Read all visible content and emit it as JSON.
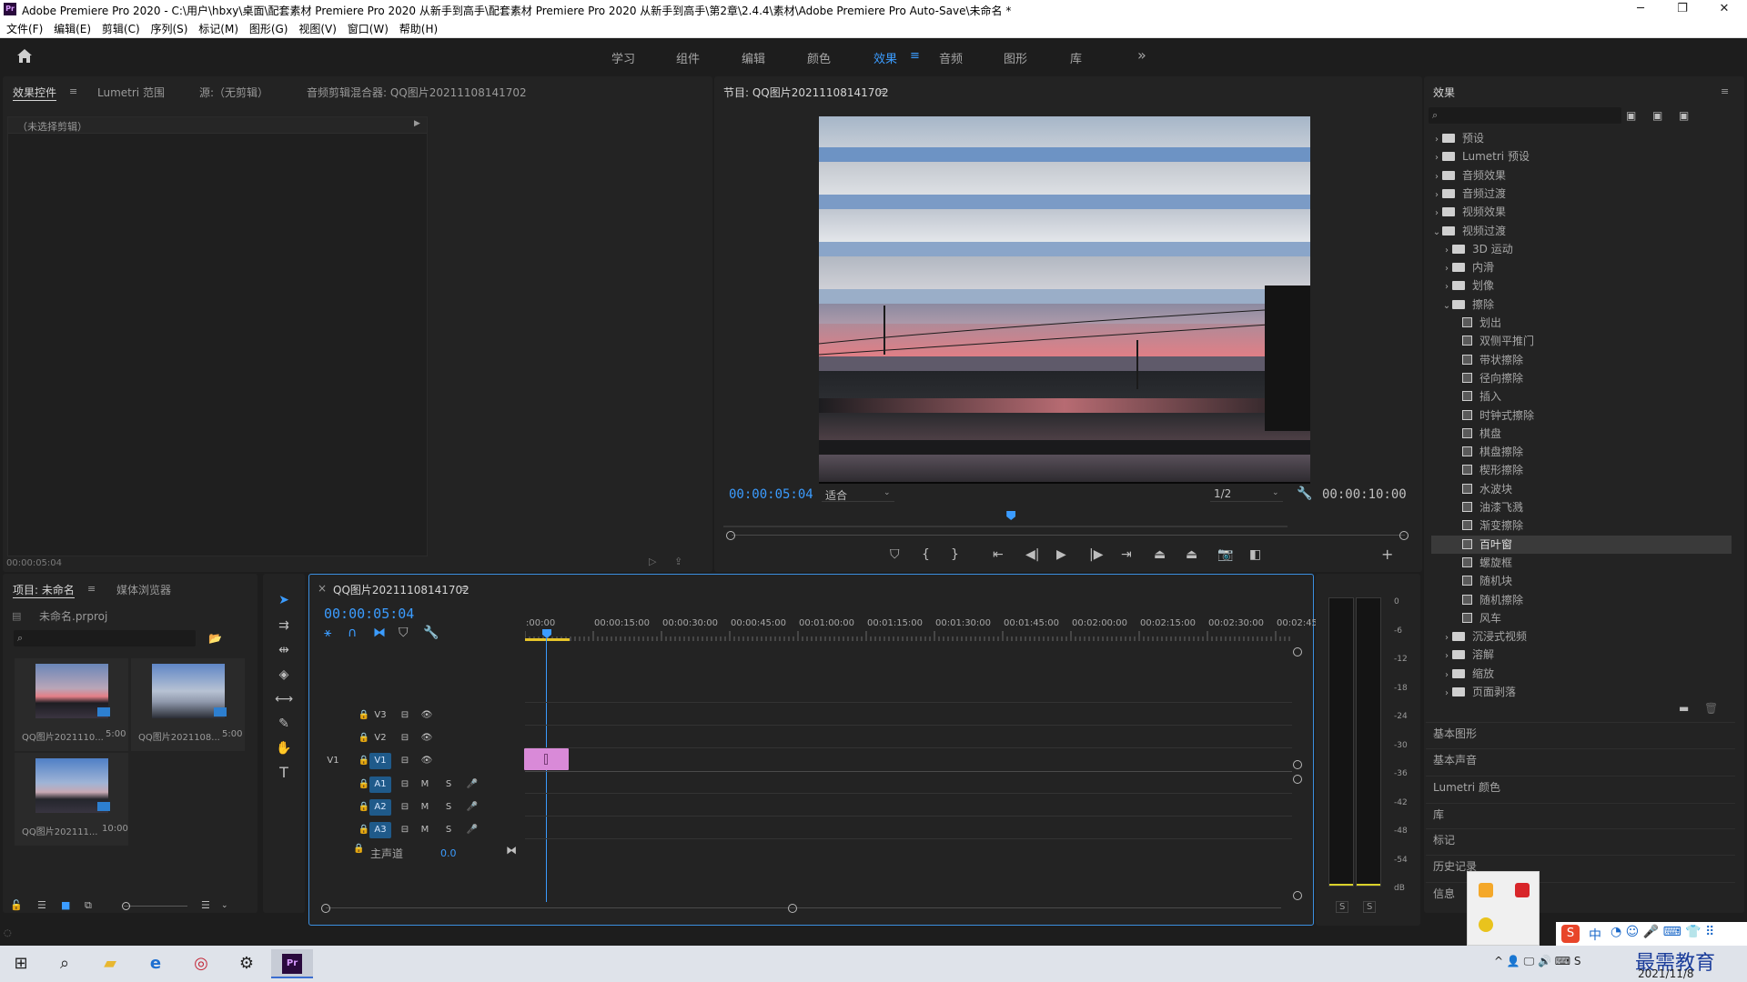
{
  "window": {
    "title": "Adobe Premiere Pro 2020 - C:\\用户\\hbxy\\桌面\\配套素材 Premiere Pro 2020 从新手到高手\\配套素材 Premiere Pro 2020 从新手到高手\\第2章\\2.4.4\\素材\\Adobe Premiere Pro Auto-Save\\未命名 *",
    "logo": "Pr",
    "minimize": "─",
    "maximize": "❐",
    "close": "✕"
  },
  "menu": [
    "文件(F)",
    "编辑(E)",
    "剪辑(C)",
    "序列(S)",
    "标记(M)",
    "图形(G)",
    "视图(V)",
    "窗口(W)",
    "帮助(H)"
  ],
  "workspaces": {
    "items": [
      "学习",
      "组件",
      "编辑",
      "颜色",
      "效果",
      "音频",
      "图形",
      "库"
    ],
    "active": "效果",
    "more": "»"
  },
  "effect_controls": {
    "tabs": [
      "效果控件",
      "Lumetri 范围",
      "源:（无剪辑）",
      "音频剪辑混合器: QQ图片20211108141702"
    ],
    "no_clip": "（未选择剪辑）",
    "timecode": "00:00:05:04"
  },
  "program": {
    "title": "节目: QQ图片20211108141702",
    "timecode": "00:00:05:04",
    "fit": "适合",
    "resolution": "1/2",
    "duration": "00:00:10:00",
    "playhead_fraction": 0.51
  },
  "effects_panel": {
    "title": "效果",
    "tree": [
      {
        "label": "预设",
        "level": 0,
        "kind": "folder-special",
        "open": false
      },
      {
        "label": "Lumetri 预设",
        "level": 0,
        "kind": "folder-special",
        "open": false
      },
      {
        "label": "音频效果",
        "level": 0,
        "kind": "folder",
        "open": false
      },
      {
        "label": "音频过渡",
        "level": 0,
        "kind": "folder",
        "open": false
      },
      {
        "label": "视频效果",
        "level": 0,
        "kind": "folder",
        "open": false
      },
      {
        "label": "视频过渡",
        "level": 0,
        "kind": "folder",
        "open": true
      },
      {
        "label": "3D 运动",
        "level": 1,
        "kind": "folder",
        "open": false
      },
      {
        "label": "内滑",
        "level": 1,
        "kind": "folder",
        "open": false
      },
      {
        "label": "划像",
        "level": 1,
        "kind": "folder",
        "open": false
      },
      {
        "label": "擦除",
        "level": 1,
        "kind": "folder",
        "open": true
      },
      {
        "label": "划出",
        "level": 2,
        "kind": "fx"
      },
      {
        "label": "双侧平推门",
        "level": 2,
        "kind": "fx"
      },
      {
        "label": "带状擦除",
        "level": 2,
        "kind": "fx"
      },
      {
        "label": "径向擦除",
        "level": 2,
        "kind": "fx"
      },
      {
        "label": "插入",
        "level": 2,
        "kind": "fx"
      },
      {
        "label": "时钟式擦除",
        "level": 2,
        "kind": "fx"
      },
      {
        "label": "棋盘",
        "level": 2,
        "kind": "fx"
      },
      {
        "label": "棋盘擦除",
        "level": 2,
        "kind": "fx"
      },
      {
        "label": "楔形擦除",
        "level": 2,
        "kind": "fx"
      },
      {
        "label": "水波块",
        "level": 2,
        "kind": "fx"
      },
      {
        "label": "油漆飞溅",
        "level": 2,
        "kind": "fx"
      },
      {
        "label": "渐变擦除",
        "level": 2,
        "kind": "fx"
      },
      {
        "label": "百叶窗",
        "level": 2,
        "kind": "fx",
        "selected": true
      },
      {
        "label": "螺旋框",
        "level": 2,
        "kind": "fx"
      },
      {
        "label": "随机块",
        "level": 2,
        "kind": "fx"
      },
      {
        "label": "随机擦除",
        "level": 2,
        "kind": "fx"
      },
      {
        "label": "风车",
        "level": 2,
        "kind": "fx"
      },
      {
        "label": "沉浸式视频",
        "level": 1,
        "kind": "folder",
        "open": false
      },
      {
        "label": "溶解",
        "level": 1,
        "kind": "folder",
        "open": false
      },
      {
        "label": "缩放",
        "level": 1,
        "kind": "folder",
        "open": false
      },
      {
        "label": "页面剥落",
        "level": 1,
        "kind": "folder",
        "open": false
      }
    ],
    "collapsed_panels": [
      "基本图形",
      "基本声音",
      "Lumetri 颜色",
      "库",
      "标记",
      "历史记录",
      "信息"
    ]
  },
  "project": {
    "tabs": [
      "项目: 未命名",
      "媒体浏览器"
    ],
    "file": "未命名.prproj",
    "items": [
      {
        "name": "QQ图片2021110...",
        "duration": "5:00"
      },
      {
        "name": "QQ图片2021108...",
        "duration": "5:00"
      },
      {
        "name": "QQ图片202111...",
        "duration": "10:00"
      }
    ]
  },
  "timeline": {
    "title": "QQ图片20211108141702",
    "close": "×",
    "timecode": "00:00:05:04",
    "ruler": [
      ":00:00",
      "00:00:15:00",
      "00:00:30:00",
      "00:00:45:00",
      "00:01:00:00",
      "00:01:15:00",
      "00:01:30:00",
      "00:01:45:00",
      "00:02:00:00",
      "00:02:15:00",
      "00:02:30:00",
      "00:02:45:"
    ],
    "video_tracks": [
      "V3",
      "V2",
      "V1"
    ],
    "source_patch": "V1",
    "audio_tracks": [
      "A1",
      "A2",
      "A3"
    ],
    "mute": "M",
    "solo": "S",
    "master": "主声道",
    "master_value": "0.0"
  },
  "audio_meter": {
    "scale": [
      "0",
      "-6",
      "-12",
      "-18",
      "-24",
      "-30",
      "-36",
      "-42",
      "-48",
      "-54",
      "dB"
    ],
    "solo": [
      "S",
      "S"
    ]
  },
  "taskbar": {
    "date": "2021/11/8",
    "watermark": "最需教育",
    "ime": "中"
  }
}
